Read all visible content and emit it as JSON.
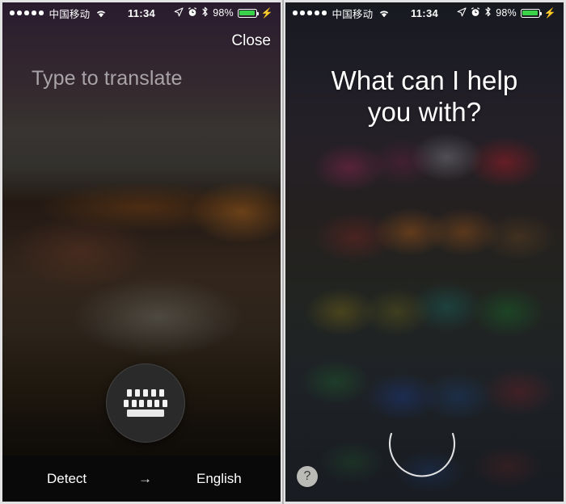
{
  "status_bar": {
    "signal_dots": 5,
    "carrier": "中国移动",
    "wifi_icon": "wifi-icon",
    "time": "11:34",
    "location_icon": "location-arrow-icon",
    "alarm_icon": "alarm-clock-icon",
    "bluetooth_icon": "bluetooth-icon",
    "battery_percent": "98%",
    "battery_level": 98,
    "charging_icon": "lightning-bolt-icon"
  },
  "left_panel": {
    "name": "translate-screen",
    "close_label": "Close",
    "input_placeholder": "Type to translate",
    "input_value": "",
    "keyboard_button": {
      "icon": "keyboard-icon",
      "top_row_keys": 5,
      "second_row_keys": 6,
      "spacebar": true
    },
    "language_bar": {
      "source_language": "Detect",
      "arrow": "→",
      "target_language": "English"
    },
    "colors": {
      "bar_background": "#090909",
      "placeholder_text": "#a8a3a6"
    }
  },
  "right_panel": {
    "name": "siri-screen",
    "prompt_line1": "What can I help",
    "prompt_line2": "you with?",
    "help_button_label": "?",
    "listening_indicator": "siri-listening-arc",
    "colors": {
      "prompt_text": "#ffffff",
      "help_button_bg": "#e2e2dc"
    }
  }
}
